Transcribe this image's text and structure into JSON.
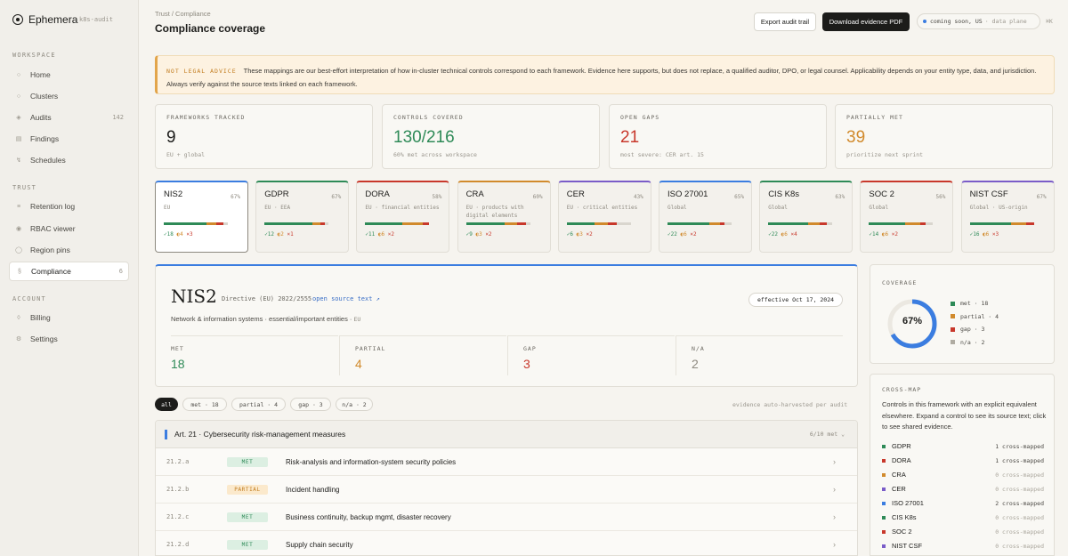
{
  "app": {
    "name": "Ephemera",
    "workspace_tag": "k8s-audit"
  },
  "sidebar": {
    "sections": [
      {
        "label": "WORKSPACE",
        "items": [
          {
            "label": "Home",
            "icon": "○"
          },
          {
            "label": "Clusters",
            "icon": "○"
          },
          {
            "label": "Audits",
            "icon": "◈",
            "count": "142"
          },
          {
            "label": "Findings",
            "icon": "▤"
          },
          {
            "label": "Schedules",
            "icon": "↯"
          }
        ]
      },
      {
        "label": "TRUST",
        "items": [
          {
            "label": "Retention log",
            "icon": "≡"
          },
          {
            "label": "RBAC viewer",
            "icon": "◉"
          },
          {
            "label": "Region pins",
            "icon": "◯"
          },
          {
            "label": "Compliance",
            "icon": "§",
            "count": "6"
          }
        ]
      },
      {
        "label": "ACCOUNT",
        "items": [
          {
            "label": "Billing",
            "icon": "◊"
          },
          {
            "label": "Settings",
            "icon": "⚙"
          }
        ]
      }
    ]
  },
  "header": {
    "breadcrumb": "Trust / Compliance",
    "title": "Compliance coverage",
    "export_label": "Export audit trail",
    "pdf_label": "Download evidence PDF",
    "region_label": "coming soon, US",
    "region_sub": "· data plane",
    "shortcut": "⌘K"
  },
  "banner": {
    "tag": "NOT LEGAL ADVICE",
    "text": "These mappings are our best-effort interpretation of how in-cluster technical controls correspond to each framework. Evidence here supports, but does not replace, a qualified auditor, DPO, or legal counsel. Applicability depends on your entity type, data, and jurisdiction. Always verify against the source texts linked on each framework."
  },
  "stats": [
    {
      "label": "FRAMEWORKS TRACKED",
      "value": "9",
      "sub": "EU + global",
      "color": "#1c1c1a"
    },
    {
      "label": "CONTROLS COVERED",
      "value": "130/216",
      "sub": "60% met across workspace",
      "color": "#2e8a57"
    },
    {
      "label": "OPEN GAPS",
      "value": "21",
      "sub": "most severe: CER art. 15",
      "color": "#c8382b"
    },
    {
      "label": "PARTIALLY MET",
      "value": "39",
      "sub": "prioritize next sprint",
      "color": "#d18a2c"
    }
  ],
  "frameworks": [
    {
      "name": "NIS2",
      "pct": "67%",
      "scope": "EU",
      "met": 18,
      "partial": 4,
      "gap": 3,
      "na": 2,
      "accent": "#3b7de0",
      "active": true
    },
    {
      "name": "GDPR",
      "pct": "67%",
      "scope": "EU · EEA",
      "met": 12,
      "partial": 2,
      "gap": 1,
      "na": 1,
      "accent": "#2e8a57",
      "active": false
    },
    {
      "name": "DORA",
      "pct": "58%",
      "scope": "EU · financial entities",
      "met": 11,
      "partial": 6,
      "gap": 2,
      "na": 0,
      "accent": "#c8382b",
      "active": false
    },
    {
      "name": "CRA",
      "pct": "60%",
      "scope": "EU · products with digital elements",
      "met": 9,
      "partial": 3,
      "gap": 2,
      "na": 1,
      "accent": "#d18a2c",
      "active": false
    },
    {
      "name": "CER",
      "pct": "43%",
      "scope": "EU · critical entities",
      "met": 6,
      "partial": 3,
      "gap": 2,
      "na": 3,
      "accent": "#7a5cc8",
      "active": false
    },
    {
      "name": "ISO 27001",
      "pct": "65%",
      "scope": "Global",
      "met": 22,
      "partial": 6,
      "gap": 2,
      "na": 4,
      "accent": "#3b7de0",
      "active": false
    },
    {
      "name": "CIS K8s",
      "pct": "63%",
      "scope": "Global",
      "met": 22,
      "partial": 6,
      "gap": 4,
      "na": 3,
      "accent": "#2e8a57",
      "active": false
    },
    {
      "name": "SOC 2",
      "pct": "56%",
      "scope": "Global",
      "met": 14,
      "partial": 6,
      "gap": 2,
      "na": 3,
      "accent": "#c8382b",
      "active": false
    },
    {
      "name": "NIST CSF",
      "pct": "67%",
      "scope": "Global · US-origin",
      "met": 16,
      "partial": 6,
      "gap": 3,
      "na": 0,
      "accent": "#7a5cc8",
      "active": false
    }
  ],
  "detail": {
    "name": "NIS2",
    "directive": "Directive (EU) 2022/2555",
    "source_link": "open source text ↗",
    "effective": "effective Oct 17, 2024",
    "description": "Network & information systems · essential/important entities ·",
    "region": "EU",
    "stats": [
      {
        "label": "MET",
        "value": "18",
        "color": "#2e8a57"
      },
      {
        "label": "PARTIAL",
        "value": "4",
        "color": "#d18a2c"
      },
      {
        "label": "GAP",
        "value": "3",
        "color": "#c8382b"
      },
      {
        "label": "N/A",
        "value": "2",
        "color": "#8d897f"
      }
    ]
  },
  "filters": {
    "chips": [
      "all",
      "met · 18",
      "partial · 4",
      "gap · 3",
      "n/a · 2"
    ],
    "note": "evidence auto-harvested per audit"
  },
  "article": {
    "title": "Art. 21 · Cybersecurity risk-management measures",
    "meta": "6/10 met ⌄",
    "rows": [
      {
        "id": "21.2.a",
        "status": "MET",
        "name": "Risk-analysis and information-system security policies"
      },
      {
        "id": "21.2.b",
        "status": "PARTIAL",
        "name": "Incident handling"
      },
      {
        "id": "21.2.c",
        "status": "MET",
        "name": "Business continuity, backup mgmt, disaster recovery"
      },
      {
        "id": "21.2.d",
        "status": "MET",
        "name": "Supply chain security"
      }
    ]
  },
  "coverage": {
    "label": "COVERAGE",
    "percent": "67%",
    "fraction": 0.67,
    "legend": [
      {
        "label": "met · 18",
        "color": "#2e8a57"
      },
      {
        "label": "partial · 4",
        "color": "#d18a2c"
      },
      {
        "label": "gap · 3",
        "color": "#c8382b"
      },
      {
        "label": "n/a · 2",
        "color": "#b0aca2"
      }
    ]
  },
  "crossmap": {
    "label": "CROSS-MAP",
    "description": "Controls in this framework with an explicit equivalent elsewhere. Expand a control to see its source text; click to see shared evidence.",
    "items": [
      {
        "name": "GDPR",
        "count": "1 cross-mapped",
        "color": "#2e8a57"
      },
      {
        "name": "DORA",
        "count": "1 cross-mapped",
        "color": "#c8382b"
      },
      {
        "name": "CRA",
        "count": "0 cross-mapped",
        "color": "#d18a2c"
      },
      {
        "name": "CER",
        "count": "0 cross-mapped",
        "color": "#7a5cc8"
      },
      {
        "name": "ISO 27001",
        "count": "2 cross-mapped",
        "color": "#3b7de0"
      },
      {
        "name": "CIS K8s",
        "count": "0 cross-mapped",
        "color": "#2e8a57"
      },
      {
        "name": "SOC 2",
        "count": "0 cross-mapped",
        "color": "#c8382b"
      },
      {
        "name": "NIST CSF",
        "count": "0 cross-mapped",
        "color": "#7a5cc8"
      }
    ]
  }
}
